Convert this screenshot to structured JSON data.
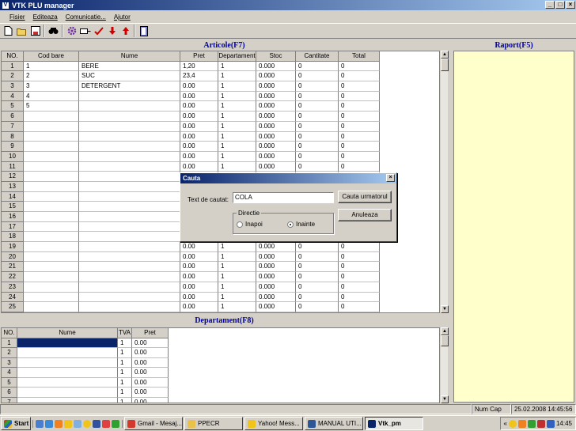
{
  "window": {
    "title": "VTK PLU manager"
  },
  "menu": [
    "Fisier",
    "Editeaza",
    "Comunicatie...",
    "Ajutor"
  ],
  "toolbar_icons": [
    "new-file-icon",
    "open-folder-icon",
    "save-icon",
    "binoculars-icon",
    "gear-icon",
    "port-icon",
    "check-icon",
    "down-arrow-icon",
    "up-arrow-icon",
    "exit-door-icon"
  ],
  "articole": {
    "title": "Articole(F7)",
    "columns": [
      "NO.",
      "Cod bare",
      "Nume",
      "Pret",
      "Departament",
      "Stoc",
      "Cantitate",
      "Total"
    ],
    "rows": [
      [
        "1",
        "1",
        "BERE",
        "1,20",
        "1",
        "0.000",
        "0",
        "0"
      ],
      [
        "2",
        "2",
        "SUC",
        "23,4",
        "1",
        "0.000",
        "0",
        "0"
      ],
      [
        "3",
        "3",
        "DETERGENT",
        "0.00",
        "1",
        "0.000",
        "0",
        "0"
      ],
      [
        "4",
        "4",
        "",
        "0.00",
        "1",
        "0.000",
        "0",
        "0"
      ],
      [
        "5",
        "5",
        "",
        "0.00",
        "1",
        "0.000",
        "0",
        "0"
      ],
      [
        "6",
        "",
        "",
        "0.00",
        "1",
        "0.000",
        "0",
        "0"
      ],
      [
        "7",
        "",
        "",
        "0.00",
        "1",
        "0.000",
        "0",
        "0"
      ],
      [
        "8",
        "",
        "",
        "0.00",
        "1",
        "0.000",
        "0",
        "0"
      ],
      [
        "9",
        "",
        "",
        "0.00",
        "1",
        "0.000",
        "0",
        "0"
      ],
      [
        "10",
        "",
        "",
        "0.00",
        "1",
        "0.000",
        "0",
        "0"
      ],
      [
        "11",
        "",
        "",
        "0.00",
        "1",
        "0.000",
        "0",
        "0"
      ],
      [
        "12",
        "",
        "",
        "",
        "",
        "",
        "",
        ""
      ],
      [
        "13",
        "",
        "",
        "",
        "",
        "",
        "",
        ""
      ],
      [
        "14",
        "",
        "",
        "",
        "",
        "",
        "",
        ""
      ],
      [
        "15",
        "",
        "",
        "",
        "",
        "",
        "",
        ""
      ],
      [
        "16",
        "",
        "",
        "",
        "",
        "",
        "",
        ""
      ],
      [
        "17",
        "",
        "",
        "",
        "",
        "",
        "",
        ""
      ],
      [
        "18",
        "",
        "",
        "",
        "",
        "",
        "",
        ""
      ],
      [
        "19",
        "",
        "",
        "0.00",
        "1",
        "0.000",
        "0",
        "0"
      ],
      [
        "20",
        "",
        "",
        "0.00",
        "1",
        "0.000",
        "0",
        "0"
      ],
      [
        "21",
        "",
        "",
        "0.00",
        "1",
        "0.000",
        "0",
        "0"
      ],
      [
        "22",
        "",
        "",
        "0.00",
        "1",
        "0.000",
        "0",
        "0"
      ],
      [
        "23",
        "",
        "",
        "0.00",
        "1",
        "0.000",
        "0",
        "0"
      ],
      [
        "24",
        "",
        "",
        "0.00",
        "1",
        "0.000",
        "0",
        "0"
      ],
      [
        "25",
        "",
        "",
        "0.00",
        "1",
        "0.000",
        "0",
        "0"
      ]
    ]
  },
  "departament": {
    "title": "Departament(F8)",
    "columns": [
      "NO.",
      "Nume",
      "TVA",
      "Pret"
    ],
    "rows": [
      [
        "1",
        "",
        "1",
        "0.00"
      ],
      [
        "2",
        "",
        "1",
        "0.00"
      ],
      [
        "3",
        "",
        "1",
        "0.00"
      ],
      [
        "4",
        "",
        "1",
        "0.00"
      ],
      [
        "5",
        "",
        "1",
        "0.00"
      ],
      [
        "6",
        "",
        "1",
        "0.00"
      ],
      [
        "7",
        "",
        "1",
        "0.00"
      ]
    ]
  },
  "raport": {
    "title": "Raport(F5)"
  },
  "dialog": {
    "title": "Cauta",
    "search_label": "Text de cautat:",
    "search_value": "COLA",
    "find_next_label": "Cauta urmatorul",
    "cancel_label": "Anuleaza",
    "direction_label": "Directie",
    "back_label": "Inapoi",
    "forward_label": "Inainte",
    "selected_direction": "Inainte"
  },
  "statusbar": {
    "keys": "Num  Cap",
    "datetime": "25.02.2008 14:45:56"
  },
  "taskbar": {
    "start_label": "Start",
    "buttons": [
      {
        "label": "Gmail - Mesaj...",
        "color": "#d33a2c"
      },
      {
        "label": "PPECR",
        "color": "#e8c24a"
      },
      {
        "label": "Yahoo! Mess...",
        "color": "#f0c419"
      },
      {
        "label": "MANUAL UTI...",
        "color": "#2b5797"
      },
      {
        "label": "Vtk_pm",
        "color": "#0a246a"
      }
    ],
    "clock": "14:45"
  },
  "colors": {
    "title_blue": "#0a246a",
    "panel_title": "#0000a0",
    "raport_bg": "#ffffcc",
    "selection": "#0a246a"
  }
}
